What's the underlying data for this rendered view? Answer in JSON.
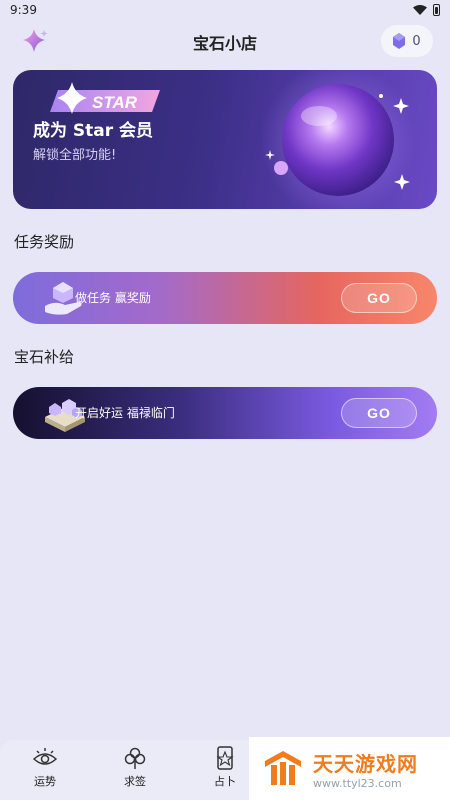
{
  "status_bar": {
    "time": "9:39"
  },
  "header": {
    "title": "宝石小店",
    "gem_count": "0"
  },
  "star_banner": {
    "badge": "STAR",
    "title": "成为 Star 会员",
    "subtitle": "解锁全部功能!"
  },
  "task_section": {
    "title": "任务奖励",
    "card_label": "做任务 赢奖励",
    "go_label": "GO"
  },
  "gem_section": {
    "title": "宝石补给",
    "card_label": "开启好运 福禄临门",
    "go_label": "GO"
  },
  "bottom_nav": {
    "items": [
      {
        "label": "运势",
        "icon": "eye-icon"
      },
      {
        "label": "求签",
        "icon": "clover-icon"
      },
      {
        "label": "占卜",
        "icon": "tarot-card-icon"
      }
    ]
  },
  "watermark": {
    "name": "天天游戏网",
    "url": "www.ttyl23.com"
  },
  "colors": {
    "background": "#e6e6f6",
    "banner": "#3b2f86",
    "task_gradient_end": "#f8866a",
    "gem_gradient_end": "#a37cf2",
    "watermark_orange": "#f07c1e"
  }
}
